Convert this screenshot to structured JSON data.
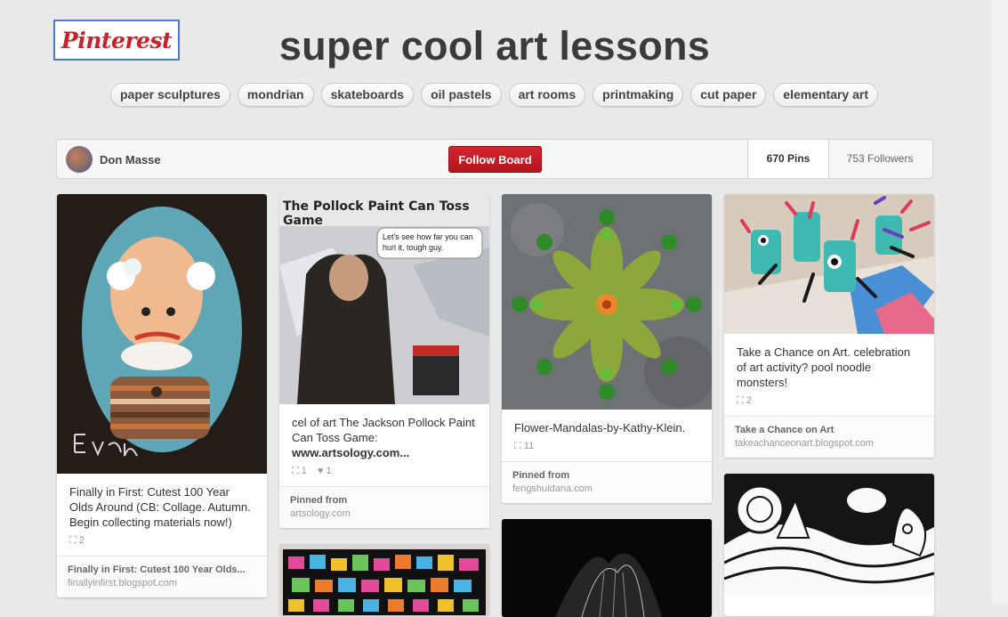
{
  "header": {
    "logo_text": "Pinterest",
    "board_title": "super cool art lessons"
  },
  "tags": [
    "paper sculptures",
    "mondrian",
    "skateboards",
    "oil pastels",
    "art rooms",
    "printmaking",
    "cut paper",
    "elementary art"
  ],
  "board": {
    "owner": "Don Masse",
    "follow_label": "Follow Board",
    "pins_label": "670 Pins",
    "followers_label": "753 Followers"
  },
  "pins": [
    {
      "desc": "Finally in First: Cutest 100 Year Olds Around (CB: Collage. Autumn. Begin collecting materials now!)",
      "repins": "2",
      "source_title": "Finally in First: Cutest 100 Year Olds...",
      "source_url": "finallyinfirst.blogspot.com"
    },
    {
      "desc": "cel of art The Jackson Pollock Paint Can Toss Game:",
      "desc_link": "www.artsology.com...",
      "repins": "1",
      "likes": "1",
      "image_title": "The Pollock Paint Can Toss Game",
      "image_bubble": "Let's see how far you can hurl it, tough guy.",
      "source_title": "Pinned from",
      "source_url": "artsology.com"
    },
    {
      "desc": "Flower-Mandalas-by-Kathy-Klein.",
      "repins": "11",
      "source_title": "Pinned from",
      "source_url": "fengshuidana.com"
    },
    {
      "desc": "Take a Chance on Art. celebration of art activity? pool noodle monsters!",
      "repins": "2",
      "source_title": "Take a Chance on Art",
      "source_url": "takeachanceonart.blogspot.com"
    }
  ],
  "colors": {
    "accent": "#c8232c",
    "background": "#e9e9e9"
  }
}
